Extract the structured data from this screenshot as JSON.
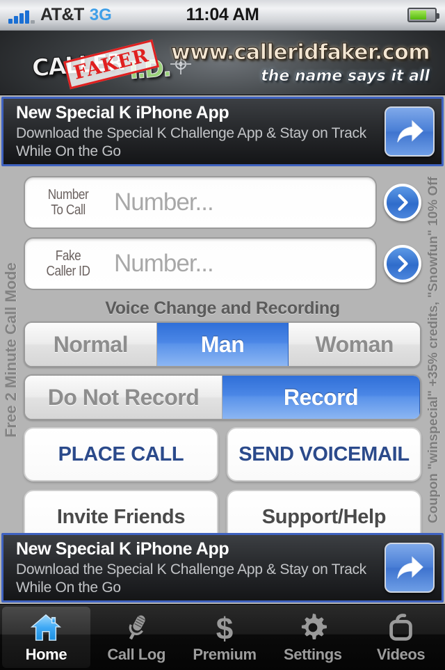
{
  "status_bar": {
    "carrier": "AT&T",
    "network": "3G",
    "time": "11:04 AM",
    "signal_icon": "signal-bars-icon",
    "battery_icon": "battery-icon"
  },
  "header": {
    "logo_word1": "CALLER",
    "logo_word2": "I.D.",
    "logo_stamp": "FAKER",
    "crosshair_icon": "crosshair-icon",
    "website": "www.calleridfaker.com",
    "tagline": "the name says it all"
  },
  "ad_top": {
    "title": "New Special K iPhone App",
    "subtitle": "Download the Special K Challenge App & Stay on Track While On the Go",
    "button_icon": "share-arrow-icon"
  },
  "ad_bottom": {
    "title": "New Special K iPhone App",
    "subtitle": "Download the Special K Challenge App & Stay on Track While On the Go",
    "button_icon": "share-arrow-icon"
  },
  "side_banners": {
    "left": "Free 2 Minute Call Mode",
    "right": "Coupon \"winspecial\" +35% credits, \"Snowfun\" 10% Off"
  },
  "form": {
    "fields": [
      {
        "label_line1": "Number",
        "label_line2": "To Call",
        "placeholder": "Number...",
        "value": "",
        "button_icon": "chevron-right-circle-icon"
      },
      {
        "label_line1": "Fake",
        "label_line2": "Caller ID",
        "placeholder": "Number...",
        "value": "",
        "button_icon": "chevron-right-circle-icon"
      }
    ],
    "section_title": "Voice Change and Recording",
    "voice_segments": [
      {
        "label": "Normal",
        "selected": false
      },
      {
        "label": "Man",
        "selected": true
      },
      {
        "label": "Woman",
        "selected": false
      }
    ],
    "record_segments": [
      {
        "label": "Do Not Record",
        "selected": false
      },
      {
        "label": "Record",
        "selected": true
      }
    ],
    "actions": [
      {
        "label": "PLACE CALL",
        "style": "primary"
      },
      {
        "label": "SEND VOICEMAIL",
        "style": "primary"
      },
      {
        "label": "Invite Friends",
        "style": "secondary"
      },
      {
        "label": "Support/Help",
        "style": "secondary"
      }
    ]
  },
  "tab_bar": {
    "tabs": [
      {
        "label": "Home",
        "icon": "home-icon",
        "active": true
      },
      {
        "label": "Call Log",
        "icon": "microphone-icon",
        "active": false
      },
      {
        "label": "Premium",
        "icon": "dollar-sign-icon",
        "active": false
      },
      {
        "label": "Settings",
        "icon": "gear-icon",
        "active": false
      },
      {
        "label": "Videos",
        "icon": "video-icon",
        "active": false
      }
    ]
  },
  "colors": {
    "accent_blue": "#2f6fd8",
    "selected_blue": "#5a93ea",
    "background_gray": "#b5b5b5",
    "primary_text_blue": "#2b4a8b",
    "banner_border": "#3f62c0",
    "active_tab_blue": "#3fa9f5"
  }
}
